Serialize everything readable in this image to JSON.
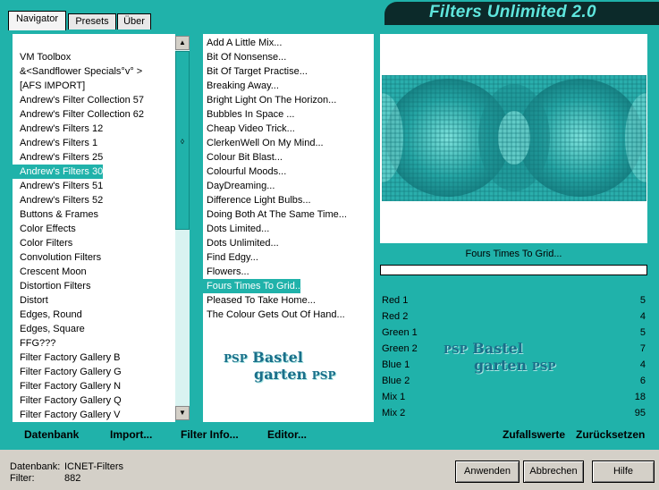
{
  "tabs": [
    {
      "label": "Navigator"
    },
    {
      "label": "Presets"
    },
    {
      "label": "Über"
    }
  ],
  "title": "Filters Unlimited 2.0",
  "categories": [
    "VM Toolbox",
    "&<Sandflower Specials°v° >",
    "[AFS IMPORT]",
    "Andrew's Filter Collection 57",
    "Andrew's Filter Collection 62",
    "Andrew's Filters 12",
    "Andrew's Filters 1",
    "Andrew's Filters 25",
    "Andrew's Filters 30",
    "Andrew's Filters 51",
    "Andrew's Filters 52",
    "Buttons & Frames",
    "Color Effects",
    "Color Filters",
    "Convolution Filters",
    "Crescent Moon",
    "Distortion Filters",
    "Distort",
    "Edges, Round",
    "Edges, Square",
    "FFG???",
    "Filter Factory Gallery B",
    "Filter Factory Gallery G",
    "Filter Factory Gallery N",
    "Filter Factory Gallery Q",
    "Filter Factory Gallery V"
  ],
  "selected_category": "Andrew's Filters 30",
  "filters": [
    "Add A Little Mix...",
    "Bit Of Nonsense...",
    "Bit Of Target Practise...",
    "Breaking Away...",
    "Bright Light On The Horizon...",
    "Bubbles In Space ...",
    "Cheap Video Trick...",
    "ClerkenWell On My Mind...",
    "Colour Bit Blast...",
    "Colourful Moods...",
    "DayDreaming...",
    "Difference Light Bulbs...",
    "Doing Both At The Same Time...",
    "Dots Limited...",
    "Dots Unlimited...",
    "Find Edgy...",
    "Flowers...",
    "Fours Times To Grid...",
    "Pleased To Take Home...",
    "The Colour Gets Out Of Hand..."
  ],
  "selected_filter": "Fours Times To Grid...",
  "sliders": [
    {
      "label": "Red 1",
      "value": "5",
      "fraction": 0.02
    },
    {
      "label": "Red 2",
      "value": "4",
      "fraction": 0.016
    },
    {
      "label": "Green 1",
      "value": "5",
      "fraction": 0.02
    },
    {
      "label": "Green 2",
      "value": "7",
      "fraction": 0.027
    },
    {
      "label": "Blue 1",
      "value": "4",
      "fraction": 0.016
    },
    {
      "label": "Blue 2",
      "value": "6",
      "fraction": 0.024
    },
    {
      "label": "Mix 1",
      "value": "18",
      "fraction": 0.07
    },
    {
      "label": "Mix 2",
      "value": "95",
      "fraction": 0.37
    }
  ],
  "watermark": {
    "line1": "Bastel",
    "line2": "garten",
    "logo": "PSP"
  },
  "footer": {
    "datenbank": "Datenbank",
    "import": "Import...",
    "filter_info": "Filter Info...",
    "editor": "Editor...",
    "zufallswerte": "Zufallswerte",
    "zuruecksetzen": "Zurücksetzen"
  },
  "status": {
    "datenbank_label": "Datenbank:",
    "datenbank_value": "ICNET-Filters",
    "filter_label": "Filter:",
    "filter_value": "882"
  },
  "buttons": {
    "apply": "Anwenden",
    "cancel": "Abbrechen",
    "help": "Hilfe"
  },
  "colors": {
    "accent": "#20b2aa",
    "title_banner": "#0c2a2a",
    "title_text": "#5fe6dd"
  }
}
